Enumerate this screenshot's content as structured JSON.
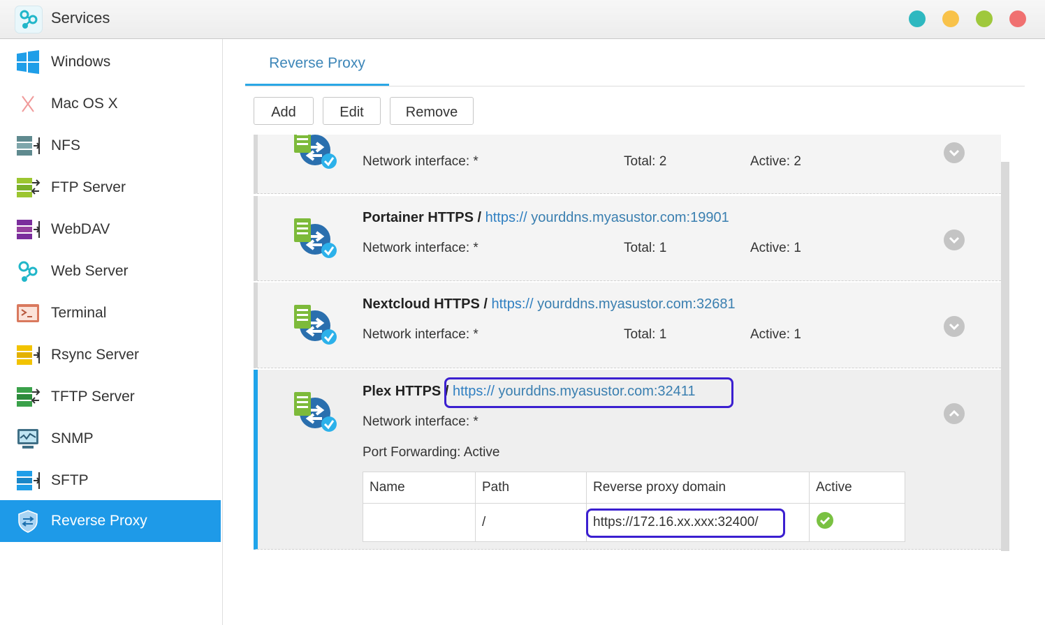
{
  "window": {
    "title": "Services",
    "controls": [
      {
        "name": "teal-dot",
        "color": "#2eb8c0"
      },
      {
        "name": "yellow-dot",
        "color": "#f8c24a"
      },
      {
        "name": "green-dot",
        "color": "#9fc83c"
      },
      {
        "name": "red-dot",
        "color": "#f07070"
      }
    ]
  },
  "sidebar": {
    "items": [
      {
        "label": "Windows",
        "icon": "windows-icon"
      },
      {
        "label": "Mac OS X",
        "icon": "mac-x-icon"
      },
      {
        "label": "NFS",
        "icon": "nfs-icon"
      },
      {
        "label": "FTP Server",
        "icon": "ftp-server-icon"
      },
      {
        "label": "WebDAV",
        "icon": "webdav-icon"
      },
      {
        "label": "Web Server",
        "icon": "web-server-icon"
      },
      {
        "label": "Terminal",
        "icon": "terminal-icon"
      },
      {
        "label": "Rsync Server",
        "icon": "rsync-server-icon"
      },
      {
        "label": "TFTP Server",
        "icon": "tftp-server-icon"
      },
      {
        "label": "SNMP",
        "icon": "snmp-icon"
      },
      {
        "label": "SFTP",
        "icon": "sftp-icon"
      },
      {
        "label": "Reverse Proxy",
        "icon": "reverse-proxy-shield-icon",
        "active": true
      }
    ]
  },
  "main": {
    "tab": "Reverse Proxy",
    "toolbar": {
      "add": "Add",
      "edit": "Edit",
      "remove": "Remove"
    },
    "rows": [
      {
        "name": "",
        "sep": "",
        "proto": "",
        "domain": "",
        "network_label": "Network interface:",
        "network_value": "*",
        "total_label": "Total:",
        "total_value": "2",
        "active_label": "Active:",
        "active_value": "2"
      },
      {
        "name": "Portainer HTTPS",
        "sep": "/",
        "proto": "https://",
        "domain": "yourddns.myasustor.com:19901",
        "network_label": "Network interface:",
        "network_value": "*",
        "total_label": "Total:",
        "total_value": "1",
        "active_label": "Active:",
        "active_value": "1"
      },
      {
        "name": "Nextcloud HTTPS",
        "sep": "/",
        "proto": "https://",
        "domain": "yourddns.myasustor.com:32681",
        "network_label": "Network interface:",
        "network_value": "*",
        "total_label": "Total:",
        "total_value": "1",
        "active_label": "Active:",
        "active_value": "1"
      },
      {
        "name": "Plex HTTPS",
        "sep": "/",
        "proto": "https://",
        "domain": "yourddns.myasustor.com:32411",
        "network_label": "Network interface:",
        "network_value": "*",
        "port_forwarding_label": "Port Forwarding:",
        "port_forwarding_value": "Active",
        "table": {
          "headers": [
            "Name",
            "Path",
            "Reverse proxy domain",
            "Active"
          ],
          "row": {
            "name": "",
            "path": "/",
            "domain": "https://172.16.xx.xxx:32400/",
            "active": "check-icon"
          }
        }
      }
    ]
  },
  "colors": {
    "accent": "#1e9ae8",
    "link": "#3a7fb0",
    "highlight": "#3b1fd0",
    "active_green": "#7ac142"
  }
}
